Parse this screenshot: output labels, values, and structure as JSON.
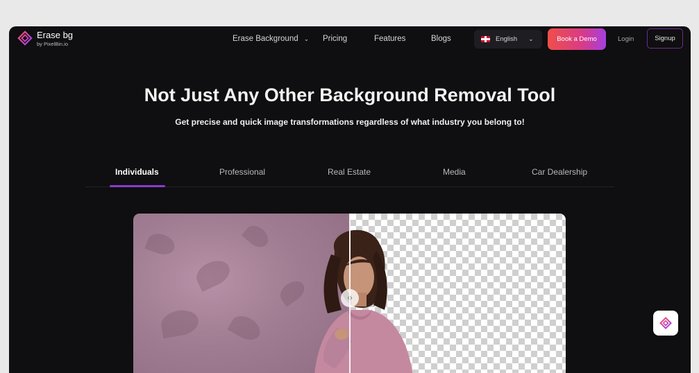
{
  "brand": {
    "name": "Erase bg",
    "sub": "by PixelBin.io"
  },
  "nav": {
    "erase_background": "Erase Background",
    "pricing": "Pricing",
    "features": "Features",
    "blogs": "Blogs",
    "language": "English",
    "book_demo": "Book a Demo",
    "login": "Login",
    "signup": "Signup"
  },
  "hero": {
    "title": "Not Just Any Other Background Removal Tool",
    "subtitle": "Get precise and quick image transformations regardless of what industry you belong to!"
  },
  "tabs": [
    "Individuals",
    "Professional",
    "Real Estate",
    "Media",
    "Car Dealership"
  ],
  "icons": [
    "logo-icon",
    "chevron-down-icon",
    "flag-uk-icon",
    "compare-handle-icon",
    "chat-widget-icon"
  ],
  "colors": {
    "accent": "#8a3bd1",
    "cta_start": "#ef4f4a",
    "cta_end": "#a53fe0",
    "background": "#0f0e10"
  }
}
